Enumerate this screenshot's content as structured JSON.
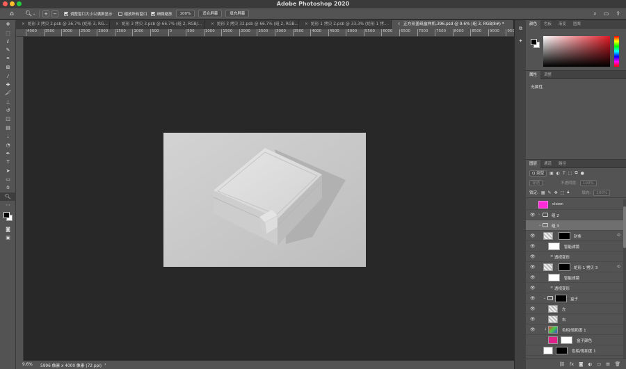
{
  "window": {
    "title": "Adobe Photoshop 2020"
  },
  "options_bar": {
    "home_icon": "home-icon",
    "zoom_icon": "magnifier-icon",
    "resize_windows": "调整窗口大小以满屏显示",
    "zoom_all": "缩放所有窗口",
    "scrubby_zoom": "细微缩放",
    "zoom_100": "100%",
    "fit_screen": "适合屏幕",
    "fill_screen": "填充屏幕"
  },
  "tabs": [
    {
      "label": "矩形 3 拷贝 2.psb @ 36.7% (矩形 3, RG..."
    },
    {
      "label": "矩形 3 拷贝 3.psb @ 66.7% (组 2, RGB/..."
    },
    {
      "label": "矩形 3 拷贝 32.psb @ 66.7% (组 2, RGB..."
    },
    {
      "label": "矩形 1 拷贝 2.psb @ 33.3% (矩形 1 拷..."
    },
    {
      "label": "正方形盖纸盒样机.396.psd @ 9.6% (组 3, RGB/8#) *"
    }
  ],
  "ruler": {
    "top_ticks": [
      "4000",
      "3500",
      "3000",
      "2500",
      "2000",
      "1500",
      "1000",
      "500",
      "0",
      "500",
      "1000",
      "1500",
      "2000",
      "2500",
      "3000",
      "3500",
      "4000",
      "4500",
      "5000",
      "5500",
      "6000",
      "6500",
      "7000",
      "7500",
      "8000",
      "8500",
      "9000",
      "9500"
    ]
  },
  "status_bar": {
    "zoom": "9.6%",
    "doc_info": "5996 像素 x 4000 像素 (72 ppi)"
  },
  "color_panel": {
    "tabs": [
      "颜色",
      "色板",
      "渐变",
      "图案"
    ],
    "fg_color": "#000000",
    "bg_color": "#ffffff",
    "hue_color": "#e01a24"
  },
  "properties_panel": {
    "tabs": [
      "属性",
      "调整"
    ],
    "empty_text": "无属性"
  },
  "layers_panel": {
    "tabs": [
      "图层",
      "通道",
      "路径"
    ],
    "filter_label": "Q 类型",
    "blend_mode": "穿透",
    "opacity_label": "不透明度:",
    "opacity_value": "100%",
    "lock_label": "锁定:",
    "fill_label": "填充:",
    "fill_value": "100%",
    "layers": [
      {
        "name": "clown",
        "kind": "clown",
        "eye": false,
        "indent": 0
      },
      {
        "name": "组 2",
        "kind": "group",
        "eye": true,
        "indent": 0
      },
      {
        "name": "组 3",
        "kind": "group-open",
        "eye": false,
        "indent": 0,
        "selected": true
      },
      {
        "name": "封条",
        "kind": "smart",
        "eye": true,
        "indent": 1,
        "extra": "⊙"
      },
      {
        "name": "智能滤镜",
        "kind": "filter",
        "eye": true,
        "indent": 2
      },
      {
        "name": "透视变形",
        "kind": "effect",
        "eye": true,
        "indent": 3
      },
      {
        "name": "矩形 1 拷贝 3",
        "kind": "smart",
        "eye": true,
        "indent": 1,
        "extra": "⊙"
      },
      {
        "name": "智能滤镜",
        "kind": "filter",
        "eye": true,
        "indent": 2
      },
      {
        "name": "透视变形",
        "kind": "effect",
        "eye": true,
        "indent": 3
      },
      {
        "name": "盒子",
        "kind": "group-mask",
        "eye": true,
        "indent": 1
      },
      {
        "name": "左",
        "kind": "plain",
        "eye": true,
        "indent": 2
      },
      {
        "name": "右",
        "kind": "plain",
        "eye": true,
        "indent": 2
      },
      {
        "name": "色相/饱和度 1",
        "kind": "adjust",
        "eye": true,
        "indent": 2
      },
      {
        "name": "盒子颜色",
        "kind": "color",
        "eye": false,
        "indent": 2
      },
      {
        "name": "色相/饱和度 1",
        "kind": "adjust-mask",
        "eye": false,
        "indent": 1
      },
      {
        "name": "组 1",
        "kind": "group",
        "eye": true,
        "indent": 0
      }
    ]
  }
}
